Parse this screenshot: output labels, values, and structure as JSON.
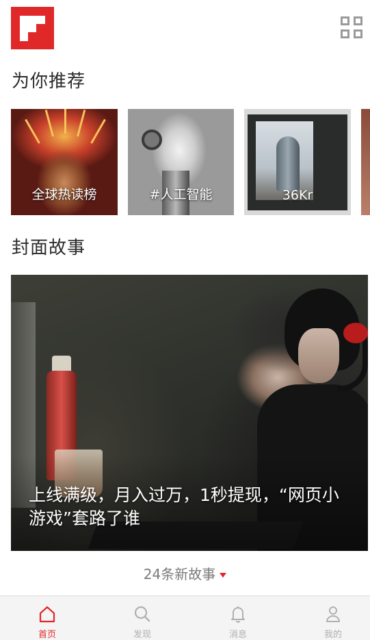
{
  "header": {
    "logo_icon": "flipboard-logo",
    "menu_icon": "grid-icon",
    "brand_color": "#e12828"
  },
  "recommend": {
    "title": "为你推荐",
    "cards": [
      {
        "label": "全球热读榜"
      },
      {
        "label": "#人工智能"
      },
      {
        "label": "36Kr"
      },
      {
        "label": ""
      }
    ]
  },
  "cover_story": {
    "title": "封面故事",
    "headline": "上线满级，月入过万，1秒提现，“网页小游戏”套路了谁"
  },
  "more_stories": {
    "label": "24条新故事",
    "caret_icon": "caret-down-icon"
  },
  "tabbar": {
    "active_color": "#e12828",
    "items": [
      {
        "label": "首页",
        "icon": "home-icon",
        "active": true
      },
      {
        "label": "发现",
        "icon": "search-icon",
        "active": false
      },
      {
        "label": "消息",
        "icon": "bell-icon",
        "active": false
      },
      {
        "label": "我的",
        "icon": "person-icon",
        "active": false
      }
    ]
  }
}
